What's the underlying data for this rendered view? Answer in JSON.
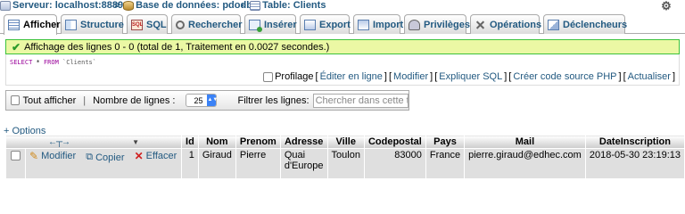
{
  "breadcrumb": {
    "server": "Serveur: localhost:8889",
    "database": "Base de données: pdodb",
    "table": "Table: Clients"
  },
  "tabs": [
    {
      "label": "Afficher",
      "icon": "browse-icon",
      "active": true
    },
    {
      "label": "Structure",
      "icon": "structure-icon"
    },
    {
      "label": "SQL",
      "icon": "sql-icon"
    },
    {
      "label": "Rechercher",
      "icon": "search-icon"
    },
    {
      "label": "Insérer",
      "icon": "insert-icon"
    },
    {
      "label": "Export",
      "icon": "export-icon"
    },
    {
      "label": "Import",
      "icon": "import-icon"
    },
    {
      "label": "Privilèges",
      "icon": "privileges-icon"
    },
    {
      "label": "Opérations",
      "icon": "operations-icon"
    },
    {
      "label": "Déclencheurs",
      "icon": "triggers-icon"
    }
  ],
  "message": "Affichage des lignes 0 - 0 (total de 1, Traitement en 0.0027 secondes.)",
  "query": {
    "select": "SELECT",
    "star": "*",
    "from": "FROM",
    "table": "`Clients`"
  },
  "query_links": {
    "profiling": "Profilage",
    "edit_inline": "Éditer en ligne",
    "edit": "Modifier",
    "explain": "Expliquer SQL",
    "php": "Créer code source PHP",
    "refresh": "Actualiser"
  },
  "nav": {
    "show_all": "Tout afficher",
    "rows_label": "Nombre de lignes :",
    "rows_value": "25",
    "filter_label": "Filtrer les lignes:",
    "filter_placeholder": "Chercher dans cette tab"
  },
  "options_label": "+ Options",
  "table": {
    "columns": [
      "Id",
      "Nom",
      "Prenom",
      "Adresse",
      "Ville",
      "Codepostal",
      "Pays",
      "Mail",
      "DateInscription"
    ],
    "actions": {
      "edit": "Modifier",
      "copy": "Copier",
      "delete": "Effacer"
    },
    "rows": [
      {
        "id": "1",
        "nom": "Giraud",
        "prenom": "Pierre",
        "adresse_l1": "Quai",
        "adresse_l2": "d'Europe",
        "ville": "Toulon",
        "codepostal": "83000",
        "pays": "France",
        "mail": "pierre.giraud@edhec.com",
        "date": "2018-05-30 23:19:13"
      }
    ]
  },
  "colors": {
    "link": "#235a81",
    "success_bg": "#ebf8a4",
    "success_border": "#3cc23c"
  }
}
